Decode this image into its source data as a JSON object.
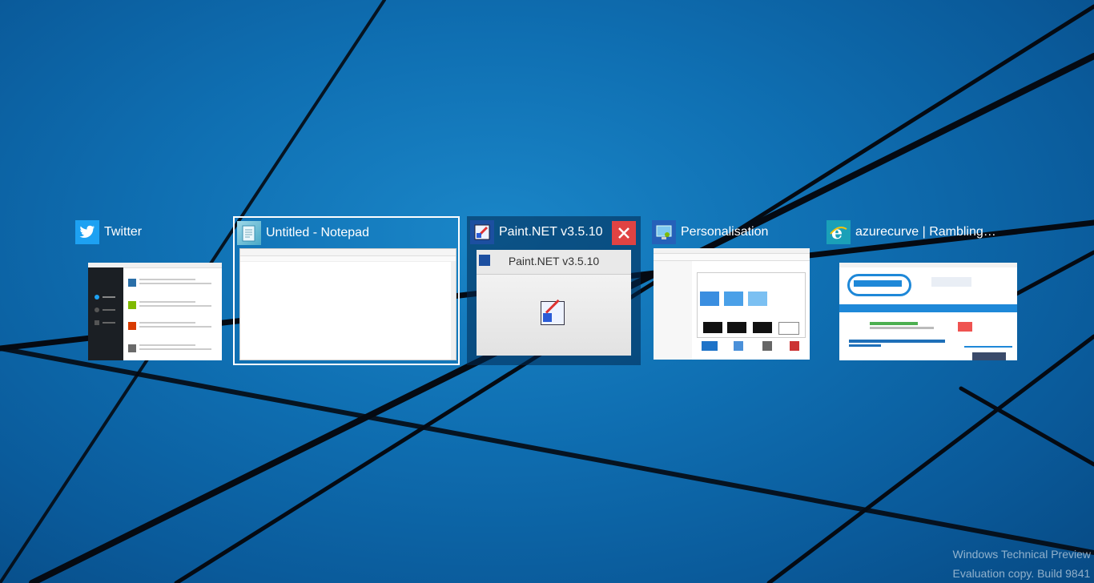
{
  "windows": [
    {
      "title": "Twitter",
      "icon": "twitter-icon"
    },
    {
      "title": "Untitled - Notepad",
      "icon": "notepad-icon"
    },
    {
      "title": "Paint.NET v3.5.10",
      "icon": "paint-net-icon",
      "thumb_title": "Paint.NET v3.5.10"
    },
    {
      "title": "Personalisation",
      "icon": "personalisation-icon"
    },
    {
      "title": "azurecurve | Ramblings ...",
      "icon": "internet-explorer-icon"
    }
  ],
  "watermark": {
    "line1": "Windows Technical Preview",
    "line2": "Evaluation copy. Build 9841"
  },
  "colors": {
    "accent": "#0f6fb2",
    "close": "#e04343",
    "twitter": "#1da1f2"
  }
}
